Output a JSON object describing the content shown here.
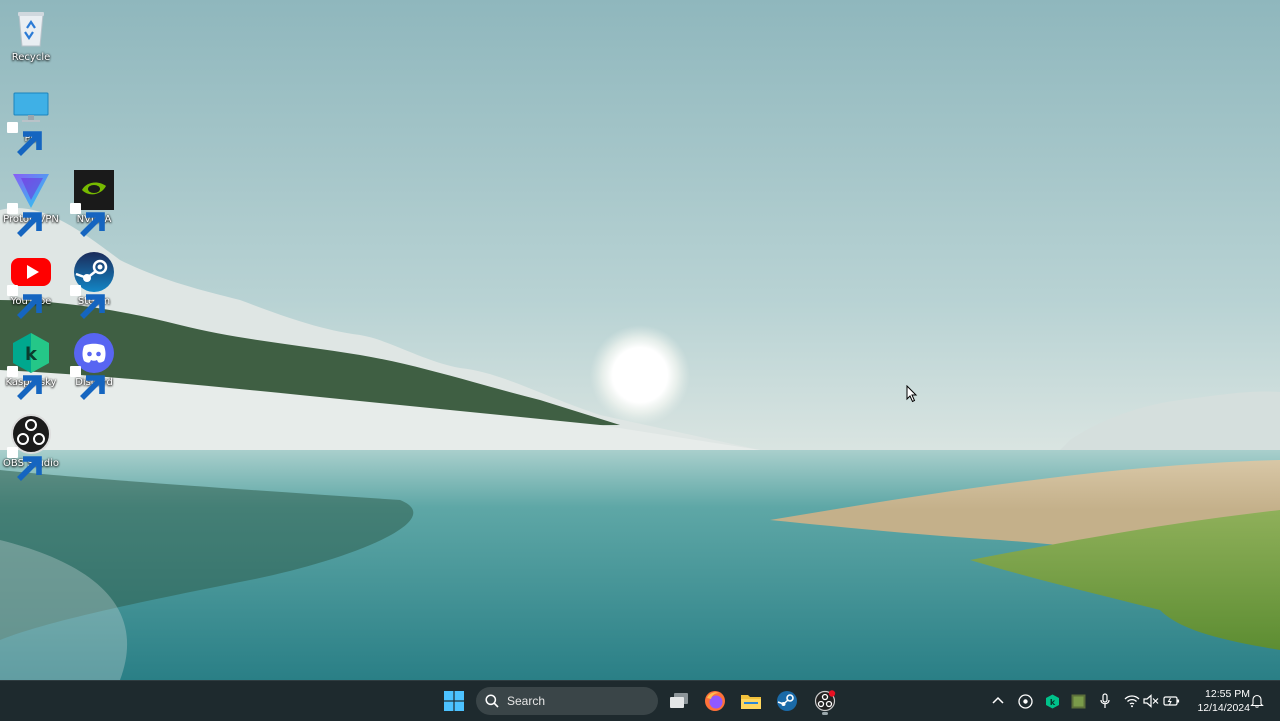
{
  "desktop": {
    "icons": [
      {
        "label": "Recycle",
        "icon": "recycle-bin-icon"
      },
      {
        "label": "PC",
        "icon": "monitor-icon"
      },
      {
        "label": "Proton VPN",
        "icon": "proton-vpn-icon"
      },
      {
        "label": "NVIDIA",
        "icon": "nvidia-icon"
      },
      {
        "label": "YouTube",
        "icon": "youtube-icon"
      },
      {
        "label": "Steam",
        "icon": "steam-icon"
      },
      {
        "label": "Kaspersky",
        "icon": "kaspersky-icon"
      },
      {
        "label": "Discord",
        "icon": "discord-icon"
      },
      {
        "label": "OBS Studio",
        "icon": "obs-icon"
      }
    ]
  },
  "taskbar": {
    "search_placeholder": "Search",
    "pinned": [
      "start-icon",
      "task-view-icon",
      "firefox-icon",
      "file-explorer-icon",
      "steam-icon",
      "obs-icon"
    ],
    "tray_icons": [
      "chevron-up-icon",
      "obs-tray-icon",
      "kaspersky-tray-icon",
      "nvidia-tray-icon",
      "microphone-icon",
      "wifi-icon",
      "speaker-muted-icon",
      "battery-icon",
      "notification-icon"
    ],
    "time": "12:55 PM",
    "date": "12/14/2024"
  },
  "colors": {
    "taskbar_bg": "#1e2a2e",
    "accent": "#4cc2ff"
  }
}
